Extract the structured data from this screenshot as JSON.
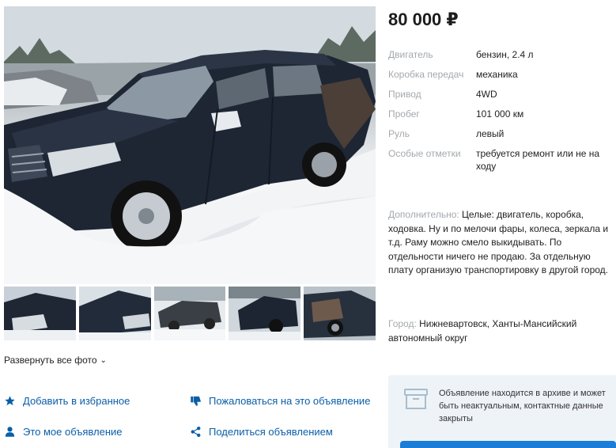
{
  "listing": {
    "price": "80 000 ₽",
    "specs": [
      {
        "label": "Двигатель",
        "value": "бензин, 2.4 л"
      },
      {
        "label": "Коробка передач",
        "value": "механика"
      },
      {
        "label": "Привод",
        "value": "4WD"
      },
      {
        "label": "Пробег",
        "value": "101 000 км"
      },
      {
        "label": "Руль",
        "value": "левый"
      },
      {
        "label": "Особые отметки",
        "value": "требуется ремонт или не на ходу"
      }
    ],
    "description_label": "Дополнительно:",
    "description": "Целые: двигатель, коробка, ходовка. Ну и по мелочи фары, колеса, зеркала и т.д. Раму можно смело выкидывать. По отдельности ничего не продаю. За отдельную плату организую транспортировку в другой город.",
    "city_label": "Город:",
    "city": "Нижневартовск, Ханты-Мансийский автономный округ"
  },
  "gallery": {
    "expand_label": "Развернуть все фото",
    "thumb_count": 5
  },
  "actions": {
    "favorite": "Добавить в избранное",
    "report": "Пожаловаться на это объявление",
    "mine": "Это мое объявление",
    "share": "Поделиться объявлением"
  },
  "archive": {
    "text": "Объявление находится в архиве и может быть неактуальным, контактные данные закрыты"
  },
  "colors": {
    "link": "#0a5ea8",
    "muted": "#a4a9ad",
    "archive_bg": "#eef3f8",
    "button": "#1a7dd8",
    "car": "#1e2634"
  },
  "icons": {
    "favorite": "star-icon",
    "report": "thumbs-down-icon",
    "mine": "user-icon",
    "share": "share-icon",
    "archive": "archive-box-icon",
    "expand": "chevron-down-icon"
  }
}
